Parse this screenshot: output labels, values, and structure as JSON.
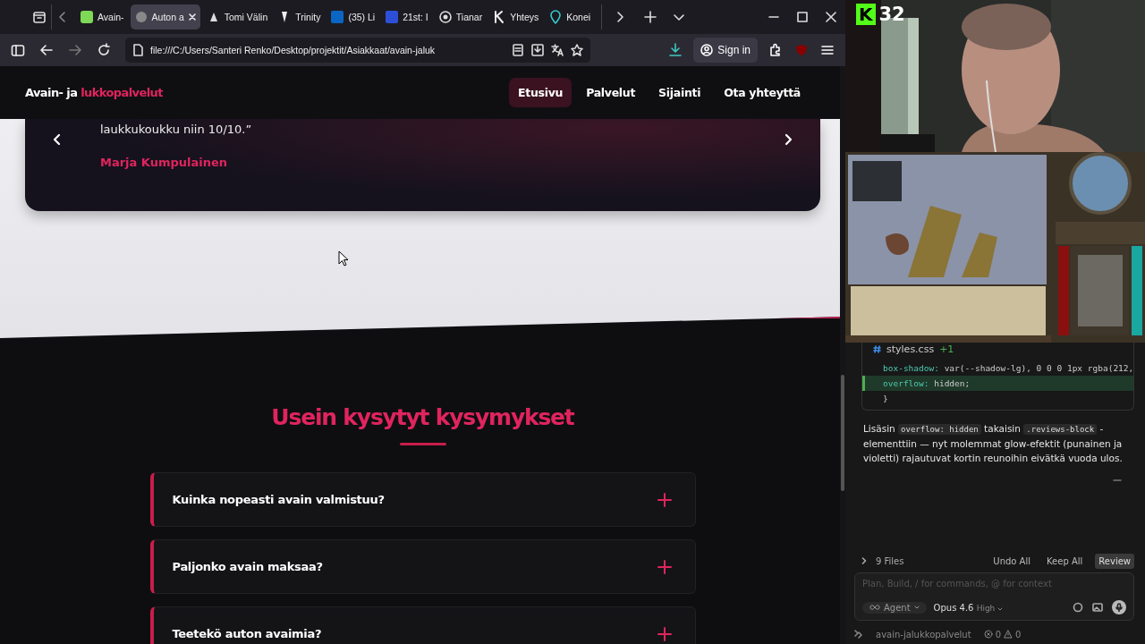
{
  "browser": {
    "tabs": [
      {
        "label": "Avain-",
        "selected": false
      },
      {
        "label": "Auton a",
        "selected": true
      },
      {
        "label": "Tomi Välin",
        "selected": false
      },
      {
        "label": "Trinity",
        "selected": false
      },
      {
        "label": "(35) Li",
        "selected": false
      },
      {
        "label": "21st: I",
        "selected": false
      },
      {
        "label": "Tianar",
        "selected": false
      },
      {
        "label": "Yhteys",
        "selected": false
      },
      {
        "label": "Konei",
        "selected": false
      }
    ],
    "url": "file:///C:/Users/Santeri Renko/Desktop/projektit/Asiakkaat/avain-jaluk",
    "sign_in": "Sign in"
  },
  "site": {
    "logo": {
      "main": "Avain- ja",
      "accent": "lukkopalvelut"
    },
    "nav": [
      {
        "label": "Etusivu",
        "selected": true
      },
      {
        "label": "Palvelut",
        "selected": false
      },
      {
        "label": "Sijainti",
        "selected": false
      },
      {
        "label": "Ota yhteyttä",
        "selected": false
      }
    ],
    "review": {
      "quote": "laukkukoukku niin 10/10.”",
      "author": "Marja Kumpulainen"
    },
    "faq": {
      "title": "Usein kysytyt kysymykset",
      "items": [
        {
          "question": "Kuinka nopeasti avain valmistuu?",
          "expanded": false
        },
        {
          "question": "Paljonko avain maksaa?",
          "expanded": false
        },
        {
          "question": "Teetekö auton avaimia?",
          "expanded": false
        }
      ]
    }
  },
  "stream": {
    "badge": {
      "logo": "K",
      "viewers": "32"
    }
  },
  "agent": {
    "file": "styles.css",
    "change": "+1",
    "code": [
      {
        "kind": "decl",
        "property": "box-shadow:",
        "value": "var(--shadow-lg), 0 0 0 1px rgba(212,",
        "added": false
      },
      {
        "kind": "decl",
        "property": "overflow:",
        "value": "hidden;",
        "added": true
      },
      {
        "kind": "brace",
        "text": "}",
        "added": false
      }
    ],
    "message": [
      {
        "kind": "text",
        "text": "Lisäsin "
      },
      {
        "kind": "code",
        "text": "overflow: hidden"
      },
      {
        "kind": "text",
        "text": " takaisin "
      },
      {
        "kind": "code",
        "text": ".reviews-block"
      },
      {
        "kind": "text",
        "text": " -elementtiin — nyt molemmat glow-efektit (punainen ja violetti) rajautuvat kortin reunoihin eivätkä vuoda ulos."
      }
    ],
    "files": "9 Files",
    "actions": [
      "Undo All",
      "Keep All",
      "Review"
    ],
    "input_placeholder": "Plan, Build, / for commands, @ for context",
    "mode": "Agent",
    "model": "Opus 4.6",
    "effort": "High",
    "status": {
      "project": "avain-jalukkopalvelut",
      "errors": "0",
      "warnings": "0"
    }
  }
}
